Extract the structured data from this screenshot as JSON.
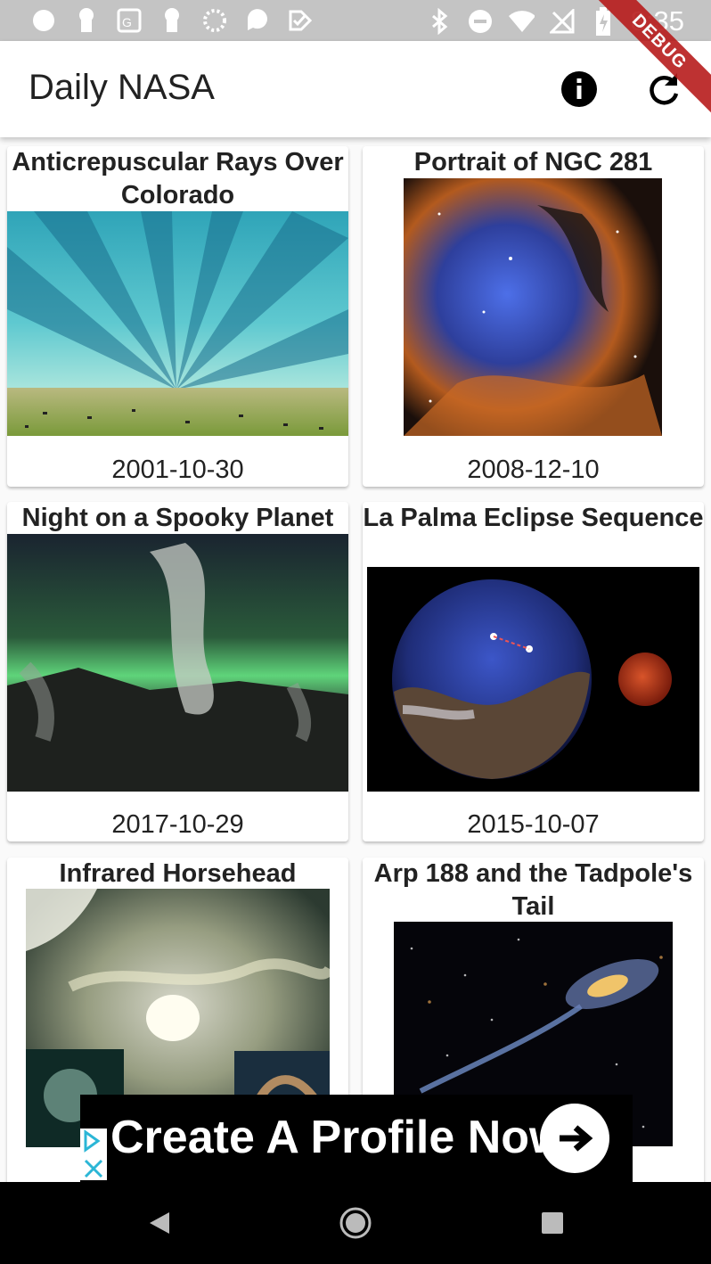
{
  "status_bar": {
    "time": "8:35",
    "left_icons": [
      "circle-icon",
      "keyhole-icon",
      "game-icon",
      "keyhole-icon",
      "spinner-icon",
      "chat-icon",
      "check-icon"
    ],
    "right_icons": [
      "bluetooth-icon",
      "do-not-disturb-icon",
      "wifi-icon",
      "no-signal-icon",
      "battery-icon"
    ]
  },
  "debug_banner": "DEBUG",
  "app_bar": {
    "title": "Daily NASA",
    "actions": [
      "info-icon",
      "refresh-icon"
    ]
  },
  "items": [
    {
      "title": "Anticrepuscular Rays Over Colorado",
      "date": "2001-10-30"
    },
    {
      "title": "Portrait of NGC 281",
      "date": "2008-12-10"
    },
    {
      "title": "Night on a Spooky Planet",
      "date": "2017-10-29"
    },
    {
      "title": "La Palma Eclipse Sequence",
      "date": "2015-10-07"
    },
    {
      "title": "Infrared Horsehead",
      "date": ""
    },
    {
      "title": "Arp 188 and the Tadpole's Tail",
      "date": ""
    }
  ],
  "ad": {
    "text": "Create A Profile Now",
    "icons": [
      "adchoices-icon",
      "close-icon",
      "arrow-right-icon"
    ]
  },
  "nav_bar": {
    "buttons": [
      "back-icon",
      "home-icon",
      "recents-icon"
    ]
  }
}
